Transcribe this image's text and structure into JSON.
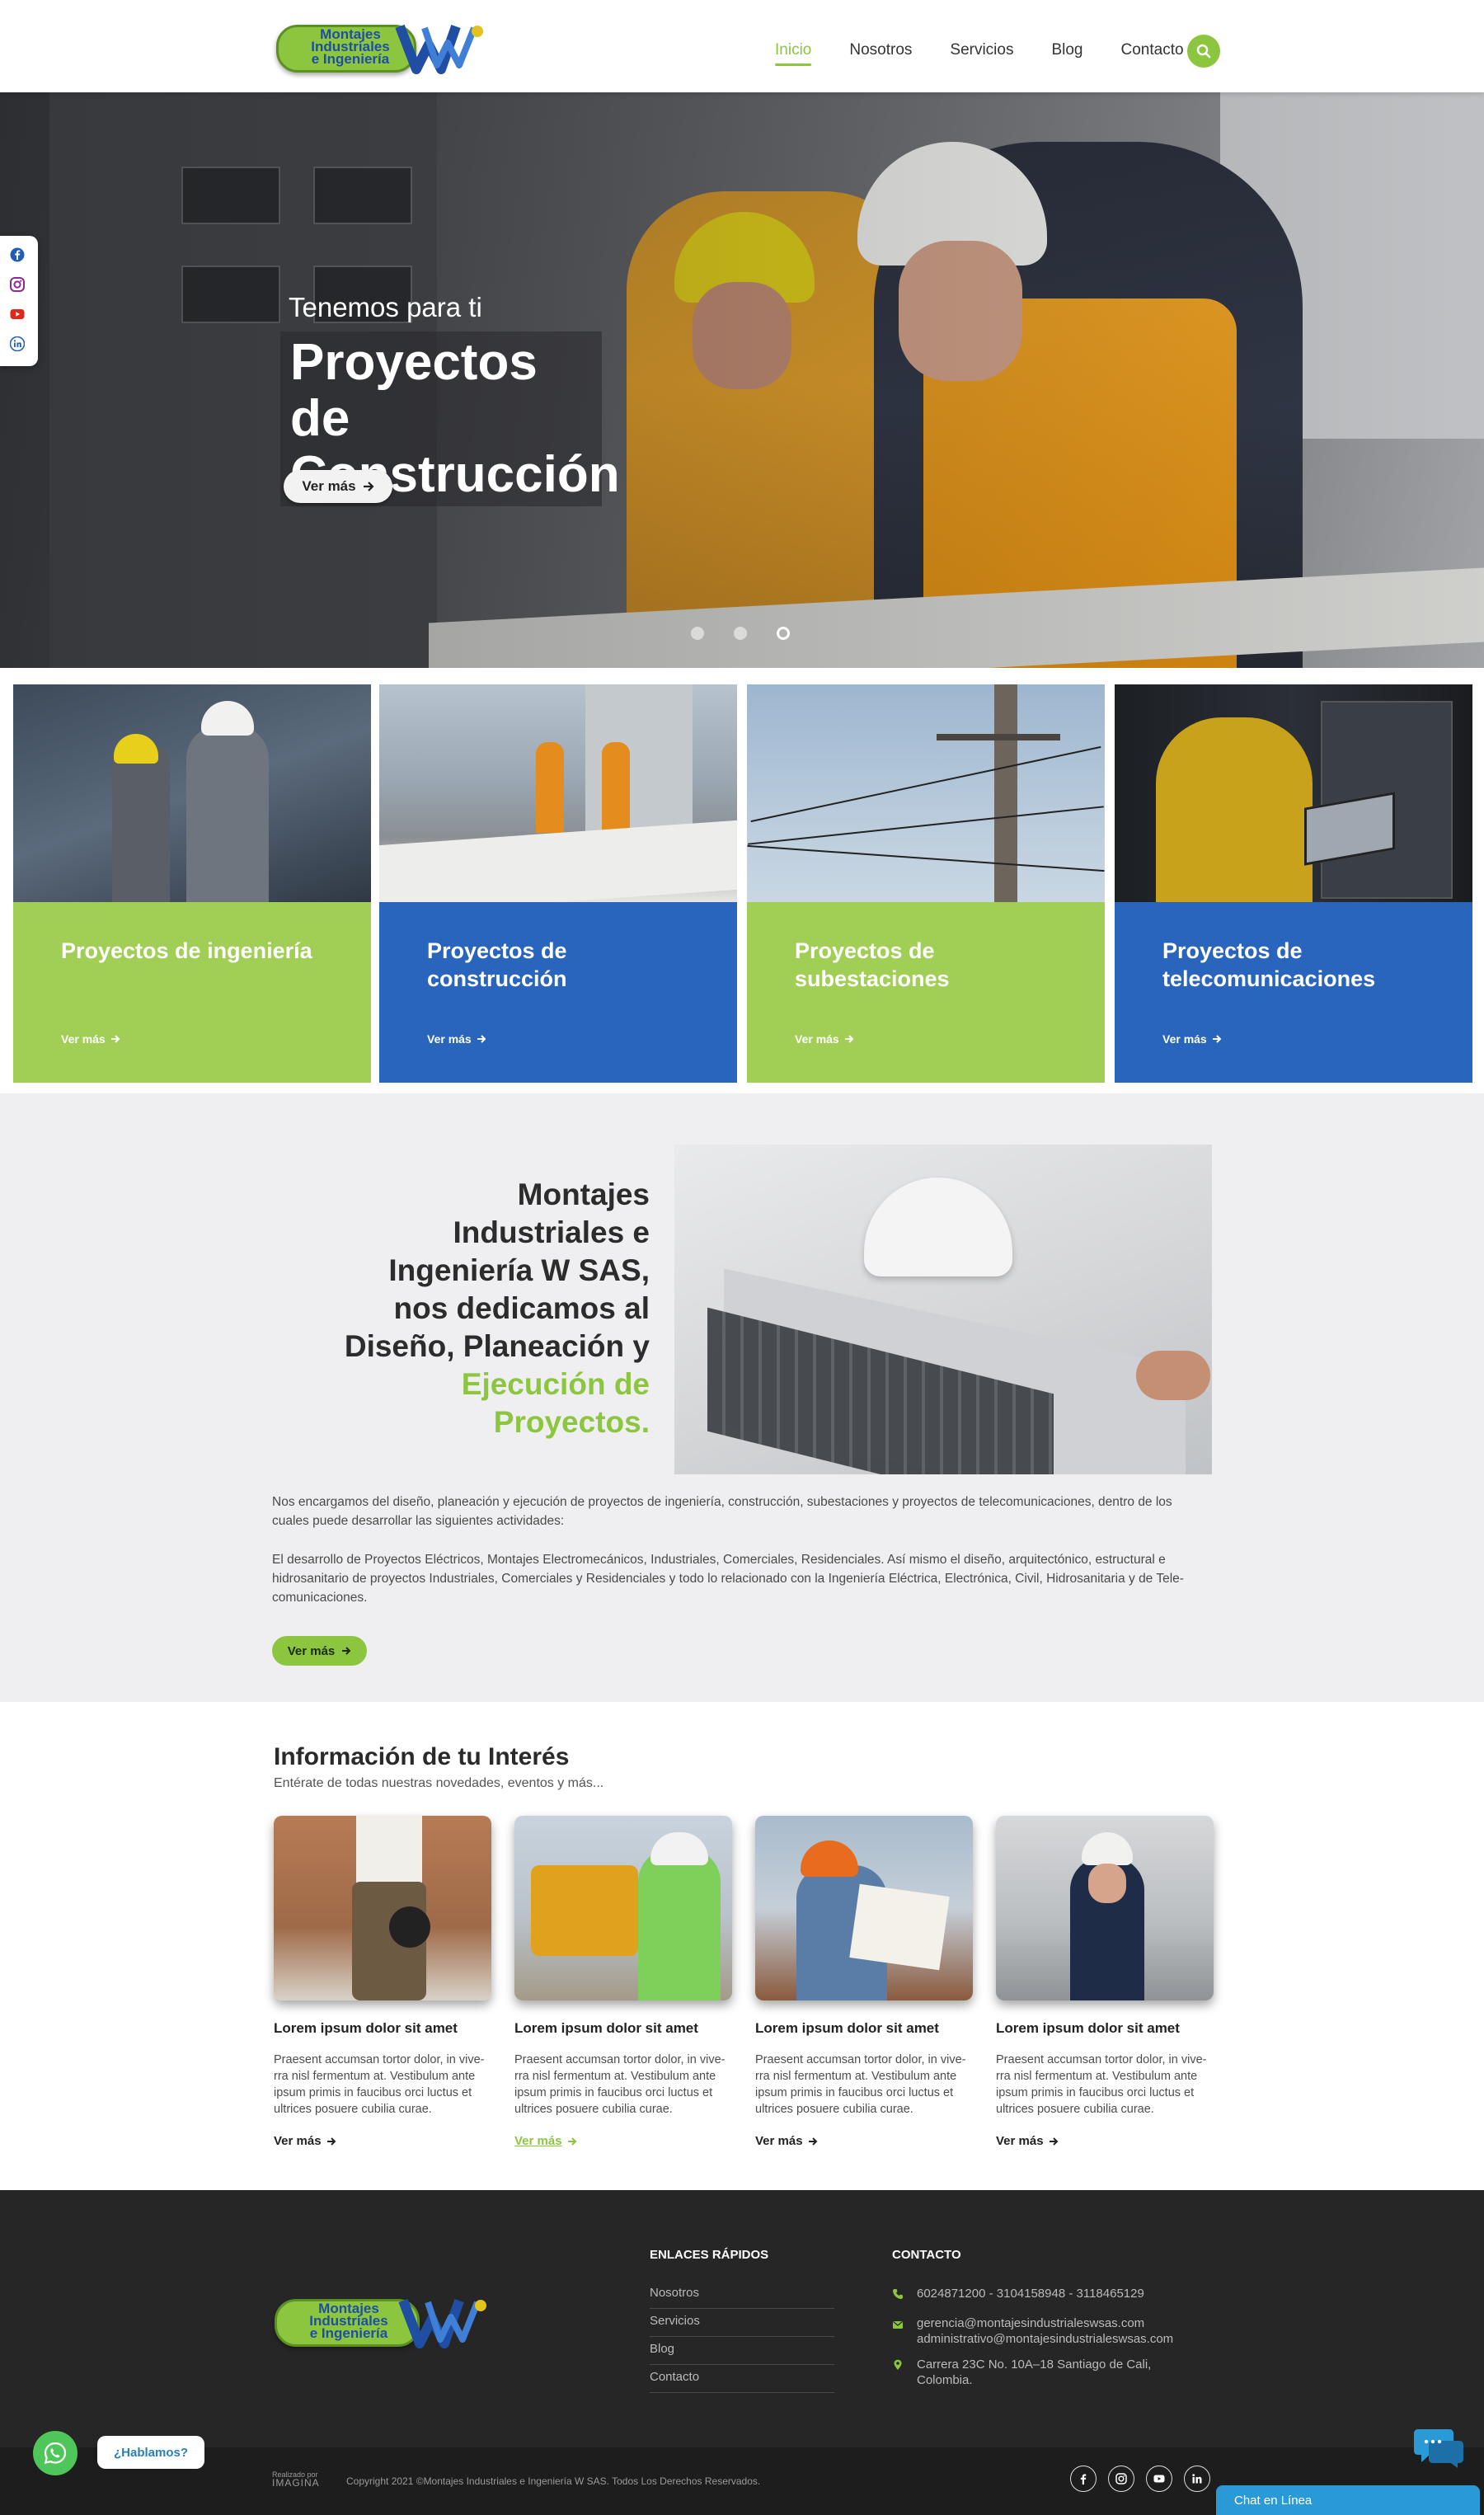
{
  "brand": {
    "logo_line1": "Montajes",
    "logo_line2": "Industriales",
    "logo_line3": "e Ingeniería"
  },
  "nav": {
    "items": [
      "Inicio",
      "Nosotros",
      "Servicios",
      "Blog",
      "Contacto"
    ],
    "active": "Inicio",
    "search_icon": "search-icon"
  },
  "hero": {
    "pretitle": "Tenemos para ti",
    "title": "Proyectos de Construcción",
    "button": "Ver más",
    "slides": 3,
    "active_slide": 3
  },
  "social": [
    "facebook-icon",
    "instagram-icon",
    "youtube-icon",
    "linkedin-icon"
  ],
  "services": [
    {
      "title": "Proyectos de ingeniería",
      "link": "Ver más",
      "color": "#a1cf55"
    },
    {
      "title": "Proyectos de construcción",
      "link": "Ver más",
      "color": "#2a65bd"
    },
    {
      "title": "Proyectos de subestaciones",
      "link": "Ver más",
      "color": "#a1cf55"
    },
    {
      "title": "Proyectos de telecomunicaciones",
      "link": "Ver más",
      "color": "#2a65bd"
    }
  ],
  "about": {
    "heading_plain": "Montajes Industriales e Ingeniería W SAS, nos dedicamos al Diseño, Planeación y",
    "heading_highlight": "Ejecución de Proyectos.",
    "paragraph1": "Nos encargamos del diseño, planeación y ejecución de proyectos de ingeniería, construcción, subestaciones y proyectos de telecomunicaciones, dentro de los cuales puede desarrollar las siguientes actividades:",
    "paragraph2": "El desarrollo de Proyectos Eléctricos, Montajes Electromecánicos, Industriales, Comerciales, Residenciales. Así mismo el diseño, arquitectónico, estructural e hidrosanitario de proyectos Industriales, Comerciales y Residenciales y todo lo relacionado con la Ingeniería Eléctrica, Electrónica, Civil, Hidrosanitaria y de Tele-comunicaciones.",
    "button": "Ver más"
  },
  "info": {
    "title": "Información de tu Interés",
    "subtitle": "Entérate de todas nuestras novedades, eventos y más...",
    "posts": [
      {
        "title": "Lorem ipsum dolor sit amet",
        "text": "Praesent accumsan tortor dolor, in vive-rra nisl fermentum at. Vestibulum ante ipsum primis in faucibus orci luctus et ultrices posuere cubilia curae.",
        "link": "Ver más"
      },
      {
        "title": "Lorem ipsum dolor sit amet",
        "text": "Praesent accumsan tortor dolor, in vive-rra nisl fermentum at. Vestibulum ante ipsum primis in faucibus orci luctus et ultrices posuere cubilia curae.",
        "link": "Ver más"
      },
      {
        "title": "Lorem ipsum dolor sit amet",
        "text": "Praesent accumsan tortor dolor, in vive-rra nisl fermentum at. Vestibulum ante ipsum primis in faucibus orci luctus et ultrices posuere cubilia curae.",
        "link": "Ver más"
      },
      {
        "title": "Lorem ipsum dolor sit amet",
        "text": "Praesent accumsan tortor dolor, in vive-rra nisl fermentum at. Vestibulum ante ipsum primis in faucibus orci luctus et ultrices posuere cubilia curae.",
        "link": "Ver más"
      }
    ]
  },
  "footer": {
    "links_title": "ENLACES RÁPIDOS",
    "links": [
      "Nosotros",
      "Servicios",
      "Blog",
      "Contacto"
    ],
    "contact_title": "CONTACTO",
    "phones": "6024871200 - 3104158948 - 3118465129",
    "email1": "gerencia@montajesindustrialeswsas.com",
    "email2": "administrativo@montajesindustrialeswsas.com",
    "address_line1": "Carrera 23C No. 10A–18 Santiago de Cali,",
    "address_line2": "Colombia.",
    "made_by_line1": "Realizado por",
    "made_by_line2": "IMAGINA",
    "copyright": "Copyright 2021 ©Montajes Industriales e Ingeniería W SAS. Todos Los Derechos Reservados.",
    "social": [
      "facebook-icon",
      "instagram-icon",
      "youtube-icon",
      "linkedin-icon"
    ]
  },
  "widgets": {
    "whatsapp_label": "¿Hablamos?",
    "chat_label": "Chat en Línea"
  },
  "colors": {
    "accent_green": "#8cc63f",
    "card_green": "#a1cf55",
    "card_blue": "#2a65bd",
    "footer_bg": "#262626"
  }
}
